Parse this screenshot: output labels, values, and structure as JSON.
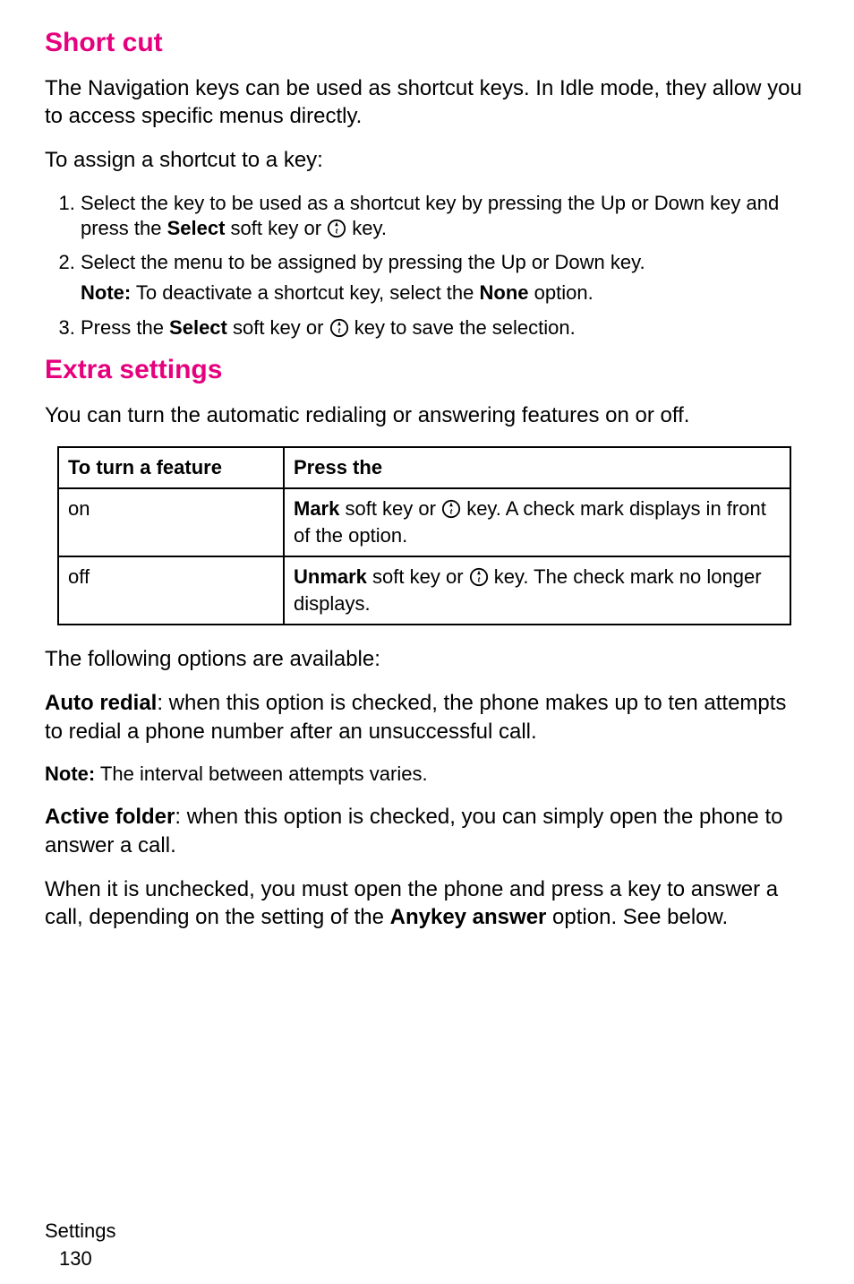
{
  "section1": {
    "title": "Short cut",
    "intro1": "The Navigation keys can be used as shortcut keys. In Idle mode, they allow you to access specific menus directly.",
    "intro2": "To assign a shortcut to a key:",
    "step1_pre": "Select the key to be used as a shortcut key by pressing the Up or Down key and press the ",
    "step1_bold": "Select",
    "step1_mid": " soft key or ",
    "step1_post": " key.",
    "step2": "Select the menu to be assigned by pressing the Up or Down key.",
    "note_label": "Note:",
    "note_text": " To deactivate a shortcut key, select the ",
    "note_bold": "None",
    "note_after": " option.",
    "step3_pre": "Press the ",
    "step3_bold": "Select",
    "step3_mid": " soft key or ",
    "step3_post": " key to save the selection."
  },
  "section2": {
    "title": "Extra settings",
    "intro": "You can turn the automatic redialing or answering features on or off."
  },
  "table": {
    "h1": "To turn a feature",
    "h2": "Press the",
    "r1c1": "on",
    "r1c2_bold": "Mark",
    "r1c2_mid": " soft key or ",
    "r1c2_post": " key. A check mark displays in front of the option.",
    "r2c1": "off",
    "r2c2_bold": "Unmark",
    "r2c2_mid": " soft key or ",
    "r2c2_post": " key. The check mark no longer displays."
  },
  "after_table": {
    "p1": "The following options are available:",
    "auto_label": "Auto redial",
    "auto_text": ": when this option is checked, the phone makes up to ten attempts to redial a phone number after an unsuccessful call.",
    "note_label": "Note:",
    "note_text": " The interval between attempts varies.",
    "active_label": "Active folder",
    "active_text": ": when this option is checked, you can simply open the phone to answer a call.",
    "unchecked_pre": "When it is unchecked, you must open the phone and press a key to answer a call, depending on the setting of the ",
    "unchecked_bold": "Anykey answer",
    "unchecked_post": " option. See below."
  },
  "footer": {
    "section": "Settings",
    "page": "130"
  },
  "icon_name": "ok-key-icon"
}
